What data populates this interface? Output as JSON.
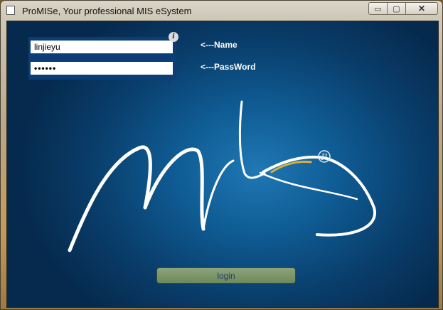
{
  "window": {
    "title": "ProMISe, Your professional MIS eSystem",
    "controls": {
      "minimize": "▭",
      "maximize": "▢",
      "close": "✕"
    }
  },
  "login_form": {
    "name_value": "linjieyu",
    "password_value": "••••••",
    "name_label": "<---Name",
    "password_label": "<---PassWord",
    "info_icon": "i",
    "login_button": "login"
  },
  "logo": {
    "registered_mark": "R"
  },
  "colors": {
    "background_center": "#1f78b4",
    "background_edge": "#062a4e",
    "button": "#7d9668",
    "button_text": "#1c3a6e"
  }
}
